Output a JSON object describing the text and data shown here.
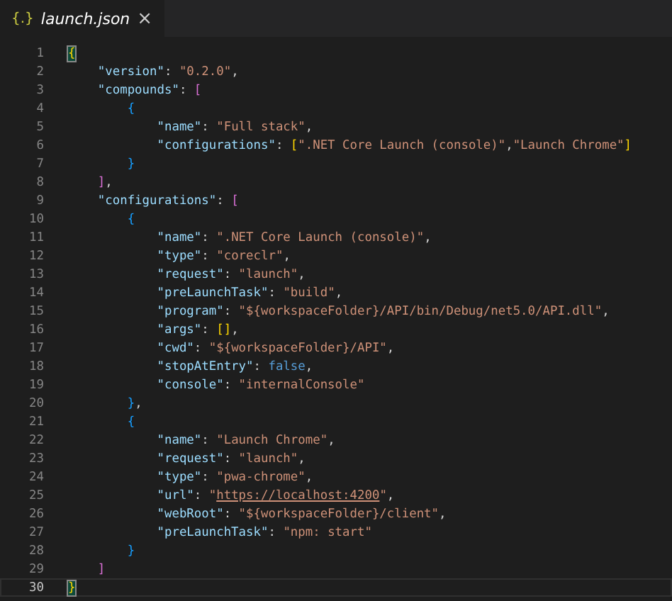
{
  "tab": {
    "icon": "{.}",
    "title": "launch.json",
    "close": "×",
    "selected": true
  },
  "lines": [
    {
      "n": "1",
      "current": false,
      "tokens": [
        {
          "kind": "b1",
          "t": "{",
          "match": true
        }
      ],
      "children": [
        {
          "n": "2",
          "current": false,
          "tokens": [
            {
              "kind": "key",
              "t": "\"version\""
            },
            {
              "kind": "p",
              "t": ": "
            },
            {
              "kind": "str",
              "t": "\"0.2.0\""
            },
            {
              "kind": "p",
              "t": ","
            }
          ]
        },
        {
          "n": "3",
          "current": false,
          "tokens": [
            {
              "kind": "key",
              "t": "\"compounds\""
            },
            {
              "kind": "p",
              "t": ": "
            },
            {
              "kind": "b2",
              "t": "["
            }
          ],
          "children": [
            {
              "n": "4",
              "current": false,
              "tokens": [
                {
                  "kind": "b3",
                  "t": "{"
                }
              ],
              "children": [
                {
                  "n": "5",
                  "current": false,
                  "tokens": [
                    {
                      "kind": "key",
                      "t": "\"name\""
                    },
                    {
                      "kind": "p",
                      "t": ": "
                    },
                    {
                      "kind": "str",
                      "t": "\"Full stack\""
                    },
                    {
                      "kind": "p",
                      "t": ","
                    }
                  ]
                },
                {
                  "n": "6",
                  "current": false,
                  "tokens": [
                    {
                      "kind": "key",
                      "t": "\"configurations\""
                    },
                    {
                      "kind": "p",
                      "t": ": "
                    },
                    {
                      "kind": "b1",
                      "t": "["
                    },
                    {
                      "kind": "str",
                      "t": "\".NET Core Launch (console)\""
                    },
                    {
                      "kind": "p",
                      "t": ","
                    },
                    {
                      "kind": "str",
                      "t": "\"Launch Chrome\""
                    },
                    {
                      "kind": "b1",
                      "t": "]"
                    }
                  ]
                }
              ]
            },
            {
              "n": "7",
              "current": false,
              "tokens": [
                {
                  "kind": "b3",
                  "t": "}"
                }
              ]
            }
          ]
        },
        {
          "n": "8",
          "current": false,
          "tokens": [
            {
              "kind": "b2",
              "t": "]"
            },
            {
              "kind": "p",
              "t": ","
            }
          ]
        },
        {
          "n": "9",
          "current": false,
          "tokens": [
            {
              "kind": "key",
              "t": "\"configurations\""
            },
            {
              "kind": "p",
              "t": ": "
            },
            {
              "kind": "b2",
              "t": "["
            }
          ],
          "children": [
            {
              "n": "10",
              "current": false,
              "tokens": [
                {
                  "kind": "b3",
                  "t": "{"
                }
              ],
              "children": [
                {
                  "n": "11",
                  "current": false,
                  "tokens": [
                    {
                      "kind": "key",
                      "t": "\"name\""
                    },
                    {
                      "kind": "p",
                      "t": ": "
                    },
                    {
                      "kind": "str",
                      "t": "\".NET Core Launch (console)\""
                    },
                    {
                      "kind": "p",
                      "t": ","
                    }
                  ]
                },
                {
                  "n": "12",
                  "current": false,
                  "tokens": [
                    {
                      "kind": "key",
                      "t": "\"type\""
                    },
                    {
                      "kind": "p",
                      "t": ": "
                    },
                    {
                      "kind": "str",
                      "t": "\"coreclr\""
                    },
                    {
                      "kind": "p",
                      "t": ","
                    }
                  ]
                },
                {
                  "n": "13",
                  "current": false,
                  "tokens": [
                    {
                      "kind": "key",
                      "t": "\"request\""
                    },
                    {
                      "kind": "p",
                      "t": ": "
                    },
                    {
                      "kind": "str",
                      "t": "\"launch\""
                    },
                    {
                      "kind": "p",
                      "t": ","
                    }
                  ]
                },
                {
                  "n": "14",
                  "current": false,
                  "tokens": [
                    {
                      "kind": "key",
                      "t": "\"preLaunchTask\""
                    },
                    {
                      "kind": "p",
                      "t": ": "
                    },
                    {
                      "kind": "str",
                      "t": "\"build\""
                    },
                    {
                      "kind": "p",
                      "t": ","
                    }
                  ]
                },
                {
                  "n": "15",
                  "current": false,
                  "tokens": [
                    {
                      "kind": "key",
                      "t": "\"program\""
                    },
                    {
                      "kind": "p",
                      "t": ": "
                    },
                    {
                      "kind": "str",
                      "t": "\"${workspaceFolder}/API/bin/Debug/net5.0/API.dll\""
                    },
                    {
                      "kind": "p",
                      "t": ","
                    }
                  ]
                },
                {
                  "n": "16",
                  "current": false,
                  "tokens": [
                    {
                      "kind": "key",
                      "t": "\"args\""
                    },
                    {
                      "kind": "p",
                      "t": ": "
                    },
                    {
                      "kind": "b1",
                      "t": "[]"
                    },
                    {
                      "kind": "p",
                      "t": ","
                    }
                  ]
                },
                {
                  "n": "17",
                  "current": false,
                  "tokens": [
                    {
                      "kind": "key",
                      "t": "\"cwd\""
                    },
                    {
                      "kind": "p",
                      "t": ": "
                    },
                    {
                      "kind": "str",
                      "t": "\"${workspaceFolder}/API\""
                    },
                    {
                      "kind": "p",
                      "t": ","
                    }
                  ]
                },
                {
                  "n": "18",
                  "current": false,
                  "tokens": [
                    {
                      "kind": "key",
                      "t": "\"stopAtEntry\""
                    },
                    {
                      "kind": "p",
                      "t": ": "
                    },
                    {
                      "kind": "bool",
                      "t": "false"
                    },
                    {
                      "kind": "p",
                      "t": ","
                    }
                  ]
                },
                {
                  "n": "19",
                  "current": false,
                  "tokens": [
                    {
                      "kind": "key",
                      "t": "\"console\""
                    },
                    {
                      "kind": "p",
                      "t": ": "
                    },
                    {
                      "kind": "str",
                      "t": "\"internalConsole\""
                    }
                  ]
                }
              ]
            },
            {
              "n": "20",
              "current": false,
              "tokens": [
                {
                  "kind": "b3",
                  "t": "}"
                },
                {
                  "kind": "p",
                  "t": ","
                }
              ]
            },
            {
              "n": "21",
              "current": false,
              "tokens": [
                {
                  "kind": "b3",
                  "t": "{"
                }
              ],
              "children": [
                {
                  "n": "22",
                  "current": false,
                  "tokens": [
                    {
                      "kind": "key",
                      "t": "\"name\""
                    },
                    {
                      "kind": "p",
                      "t": ": "
                    },
                    {
                      "kind": "str",
                      "t": "\"Launch Chrome\""
                    },
                    {
                      "kind": "p",
                      "t": ","
                    }
                  ]
                },
                {
                  "n": "23",
                  "current": false,
                  "tokens": [
                    {
                      "kind": "key",
                      "t": "\"request\""
                    },
                    {
                      "kind": "p",
                      "t": ": "
                    },
                    {
                      "kind": "str",
                      "t": "\"launch\""
                    },
                    {
                      "kind": "p",
                      "t": ","
                    }
                  ]
                },
                {
                  "n": "24",
                  "current": false,
                  "tokens": [
                    {
                      "kind": "key",
                      "t": "\"type\""
                    },
                    {
                      "kind": "p",
                      "t": ": "
                    },
                    {
                      "kind": "str",
                      "t": "\"pwa-chrome\""
                    },
                    {
                      "kind": "p",
                      "t": ","
                    }
                  ]
                },
                {
                  "n": "25",
                  "current": false,
                  "tokens": [
                    {
                      "kind": "key",
                      "t": "\"url\""
                    },
                    {
                      "kind": "p",
                      "t": ": "
                    },
                    {
                      "kind": "str",
                      "t": "\""
                    },
                    {
                      "kind": "link",
                      "t": "https://localhost:4200"
                    },
                    {
                      "kind": "str",
                      "t": "\""
                    },
                    {
                      "kind": "p",
                      "t": ","
                    }
                  ]
                },
                {
                  "n": "26",
                  "current": false,
                  "tokens": [
                    {
                      "kind": "key",
                      "t": "\"webRoot\""
                    },
                    {
                      "kind": "p",
                      "t": ": "
                    },
                    {
                      "kind": "str",
                      "t": "\"${workspaceFolder}/client\""
                    },
                    {
                      "kind": "p",
                      "t": ","
                    }
                  ]
                },
                {
                  "n": "27",
                  "current": false,
                  "tokens": [
                    {
                      "kind": "key",
                      "t": "\"preLaunchTask\""
                    },
                    {
                      "kind": "p",
                      "t": ": "
                    },
                    {
                      "kind": "str",
                      "t": "\"npm: start\""
                    }
                  ]
                }
              ]
            },
            {
              "n": "28",
              "current": false,
              "tokens": [
                {
                  "kind": "b3",
                  "t": "}"
                }
              ]
            }
          ]
        },
        {
          "n": "29",
          "current": false,
          "tokens": [
            {
              "kind": "b2",
              "t": "]"
            }
          ]
        }
      ]
    },
    {
      "n": "30",
      "current": true,
      "tokens": [
        {
          "kind": "b1",
          "t": "}",
          "match": true
        }
      ]
    }
  ]
}
